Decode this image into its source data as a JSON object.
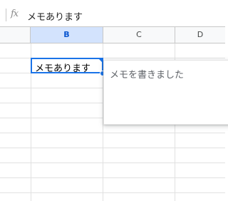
{
  "formula_bar": {
    "fx_label": "fx",
    "value": "メモあります"
  },
  "columns": [
    "B",
    "C",
    "D"
  ],
  "selected_column": "B",
  "active_cell": {
    "value": "メモあります"
  },
  "note": {
    "text": "メモを書きました"
  },
  "colors": {
    "selection": "#1a73e8",
    "header_selected_bg": "#d3e3fd",
    "grid_line": "#e1e1e1"
  }
}
